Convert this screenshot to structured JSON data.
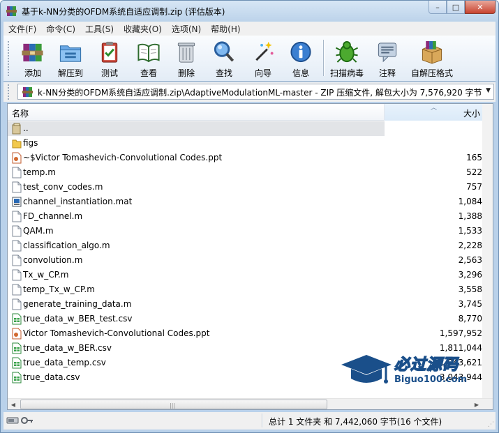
{
  "window": {
    "title": "基于k-NN分类的OFDM系统自适应调制.zip (评估版本)",
    "minimize": "–",
    "maximize": "□",
    "close": "✕"
  },
  "menu": [
    "文件(F)",
    "命令(C)",
    "工具(S)",
    "收藏夹(O)",
    "选项(N)",
    "帮助(H)"
  ],
  "toolbar": {
    "add": "添加",
    "extract": "解压到",
    "test": "测试",
    "view": "查看",
    "delete": "删除",
    "find": "查找",
    "wizard": "向导",
    "info": "信息",
    "virus": "扫描病毒",
    "comment": "注释",
    "sfx": "自解压格式"
  },
  "address": {
    "path": "k-NN分类的OFDM系统自适应调制.zip\\AdaptiveModulationML-master - ZIP 压缩文件, 解包大小为 7,576,920 字节"
  },
  "columns": {
    "name": "名称",
    "size": "大小"
  },
  "files": [
    {
      "name": "..",
      "size": "",
      "type": "up"
    },
    {
      "name": "figs",
      "size": "",
      "type": "folder"
    },
    {
      "name": "~$Victor Tomashevich-Convolutional Codes.ppt",
      "size": "165",
      "type": "ppt"
    },
    {
      "name": "temp.m",
      "size": "522",
      "type": "m"
    },
    {
      "name": "test_conv_codes.m",
      "size": "757",
      "type": "m"
    },
    {
      "name": "channel_instantiation.mat",
      "size": "1,084",
      "type": "mat"
    },
    {
      "name": "FD_channel.m",
      "size": "1,388",
      "type": "m"
    },
    {
      "name": "QAM.m",
      "size": "1,533",
      "type": "m"
    },
    {
      "name": "classification_algo.m",
      "size": "2,228",
      "type": "m"
    },
    {
      "name": "convolution.m",
      "size": "2,563",
      "type": "m"
    },
    {
      "name": "Tx_w_CP.m",
      "size": "3,296",
      "type": "m"
    },
    {
      "name": "temp_Tx_w_CP.m",
      "size": "3,558",
      "type": "m"
    },
    {
      "name": "generate_training_data.m",
      "size": "3,745",
      "type": "m"
    },
    {
      "name": "true_data_w_BER_test.csv",
      "size": "8,770",
      "type": "csv"
    },
    {
      "name": "Victor Tomashevich-Convolutional Codes.ppt",
      "size": "1,597,952",
      "type": "ppt"
    },
    {
      "name": "true_data_w_BER.csv",
      "size": "1,811,044",
      "type": "csv"
    },
    {
      "name": "true_data_temp.csv",
      "size": "1,943,621",
      "type": "csv"
    },
    {
      "name": "true_data.csv",
      "size": "3,043,944",
      "type": "csv"
    }
  ],
  "status": {
    "summary": "总计 1 文件夹 和 7,442,060 字节(16 个文件)"
  },
  "watermark": {
    "title": "必过源码",
    "url": "Biguo100.com"
  },
  "colors": {
    "frame": "#b9d1ea",
    "sort_column": "#dbeaf8",
    "selected_row": "#e2e4e7",
    "watermark_blue": "#1a4f8a"
  }
}
